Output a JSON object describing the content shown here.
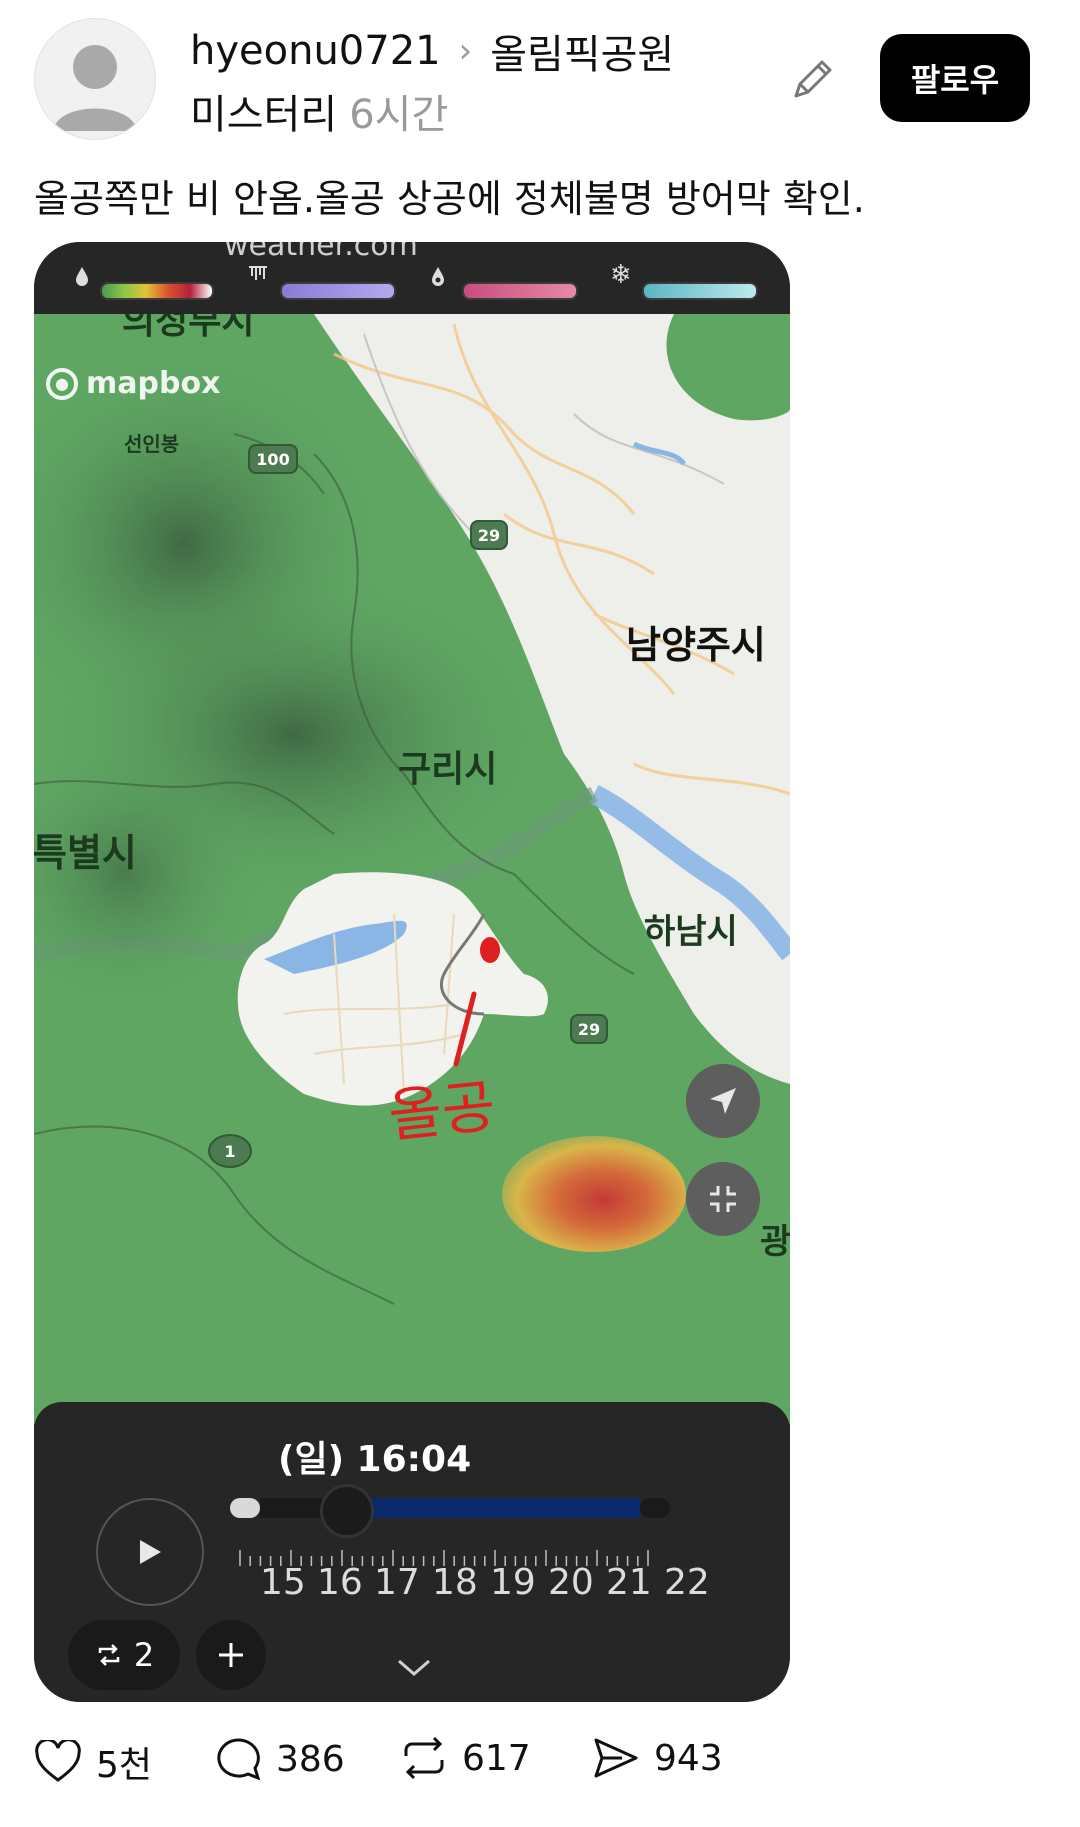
{
  "post": {
    "username": "hyeonu0721",
    "separator": "›",
    "community": "올림픽공원",
    "flair": "미스터리",
    "time": "6시간",
    "follow_label": "팔로우",
    "caption": "올공쪽만 비 안옴.올공 상공에 정체불명 방어막 확인."
  },
  "weather_app": {
    "watermark": "weather.com",
    "mapbox_label": "mapbox",
    "legend_icons": [
      "raindrop-icon",
      "ice-icon",
      "mixed-icon",
      "snowflake-icon"
    ],
    "map_labels": {
      "uijeongbu": "의정부시",
      "seoninbong": "선인봉",
      "namyangju": "남양주시",
      "guri": "구리시",
      "seoul": "특별시",
      "hanam": "하남시",
      "gwangju_partial": "광",
      "handwritten": "올공"
    },
    "highway_numbers": {
      "route_100": "100",
      "route_29_a": "29",
      "route_29_b": "29",
      "route_1": "1"
    },
    "time_label": "(일) 16:04",
    "hours": [
      "15",
      "16",
      "17",
      "18",
      "19",
      "20",
      "21",
      "22"
    ],
    "repeat_count": "2",
    "colors": {
      "radar_green": "#5fa663",
      "radar_dark": "#3d6b42",
      "track_blue": "#0b2a6e",
      "storm_red": "#c43a36",
      "storm_yellow": "#d9b54a"
    }
  },
  "actions": {
    "likes": "5천",
    "comments": "386",
    "reposts": "617",
    "shares": "943"
  }
}
